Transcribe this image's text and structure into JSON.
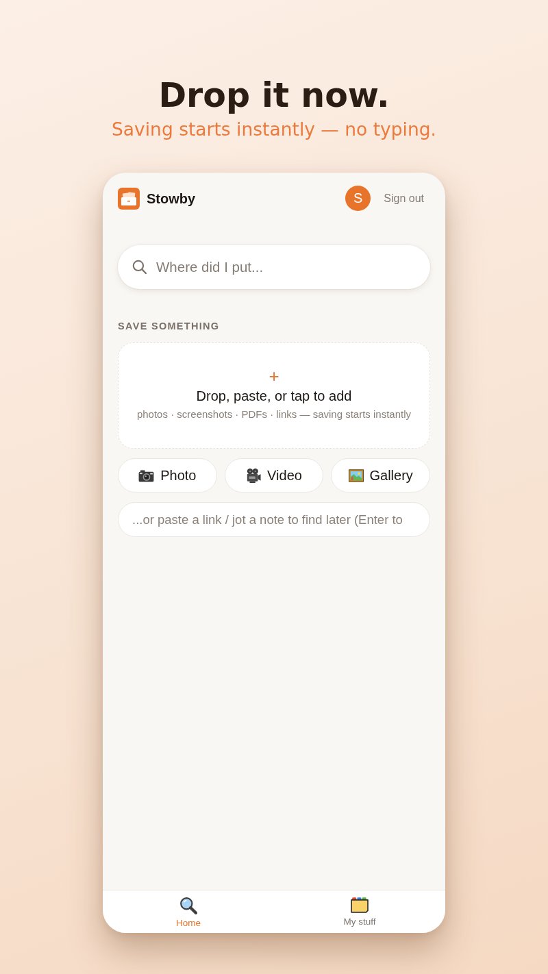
{
  "hero": {
    "title": "Drop it now.",
    "subtitle": "Saving starts instantly — no typing."
  },
  "app": {
    "brand": "Stowby",
    "avatar_initial": "S",
    "sign_out": "Sign out",
    "search": {
      "placeholder": "Where did I put..."
    },
    "section_title": "SAVE SOMETHING",
    "dropzone": {
      "plus": "+",
      "title": "Drop, paste, or tap to add",
      "hint": "photos · screenshots · PDFs · links — saving starts instantly"
    },
    "capture_buttons": [
      {
        "kind": "camera",
        "label": "Photo"
      },
      {
        "kind": "video",
        "label": "Video"
      },
      {
        "kind": "gallery",
        "label": "Gallery"
      }
    ],
    "note": {
      "placeholder": "...or paste a link / jot a note to find later (Enter to"
    },
    "tabs": [
      {
        "kind": "search",
        "label": "Home",
        "selected": true
      },
      {
        "kind": "folder",
        "label": "My stuff",
        "selected": false
      }
    ]
  }
}
